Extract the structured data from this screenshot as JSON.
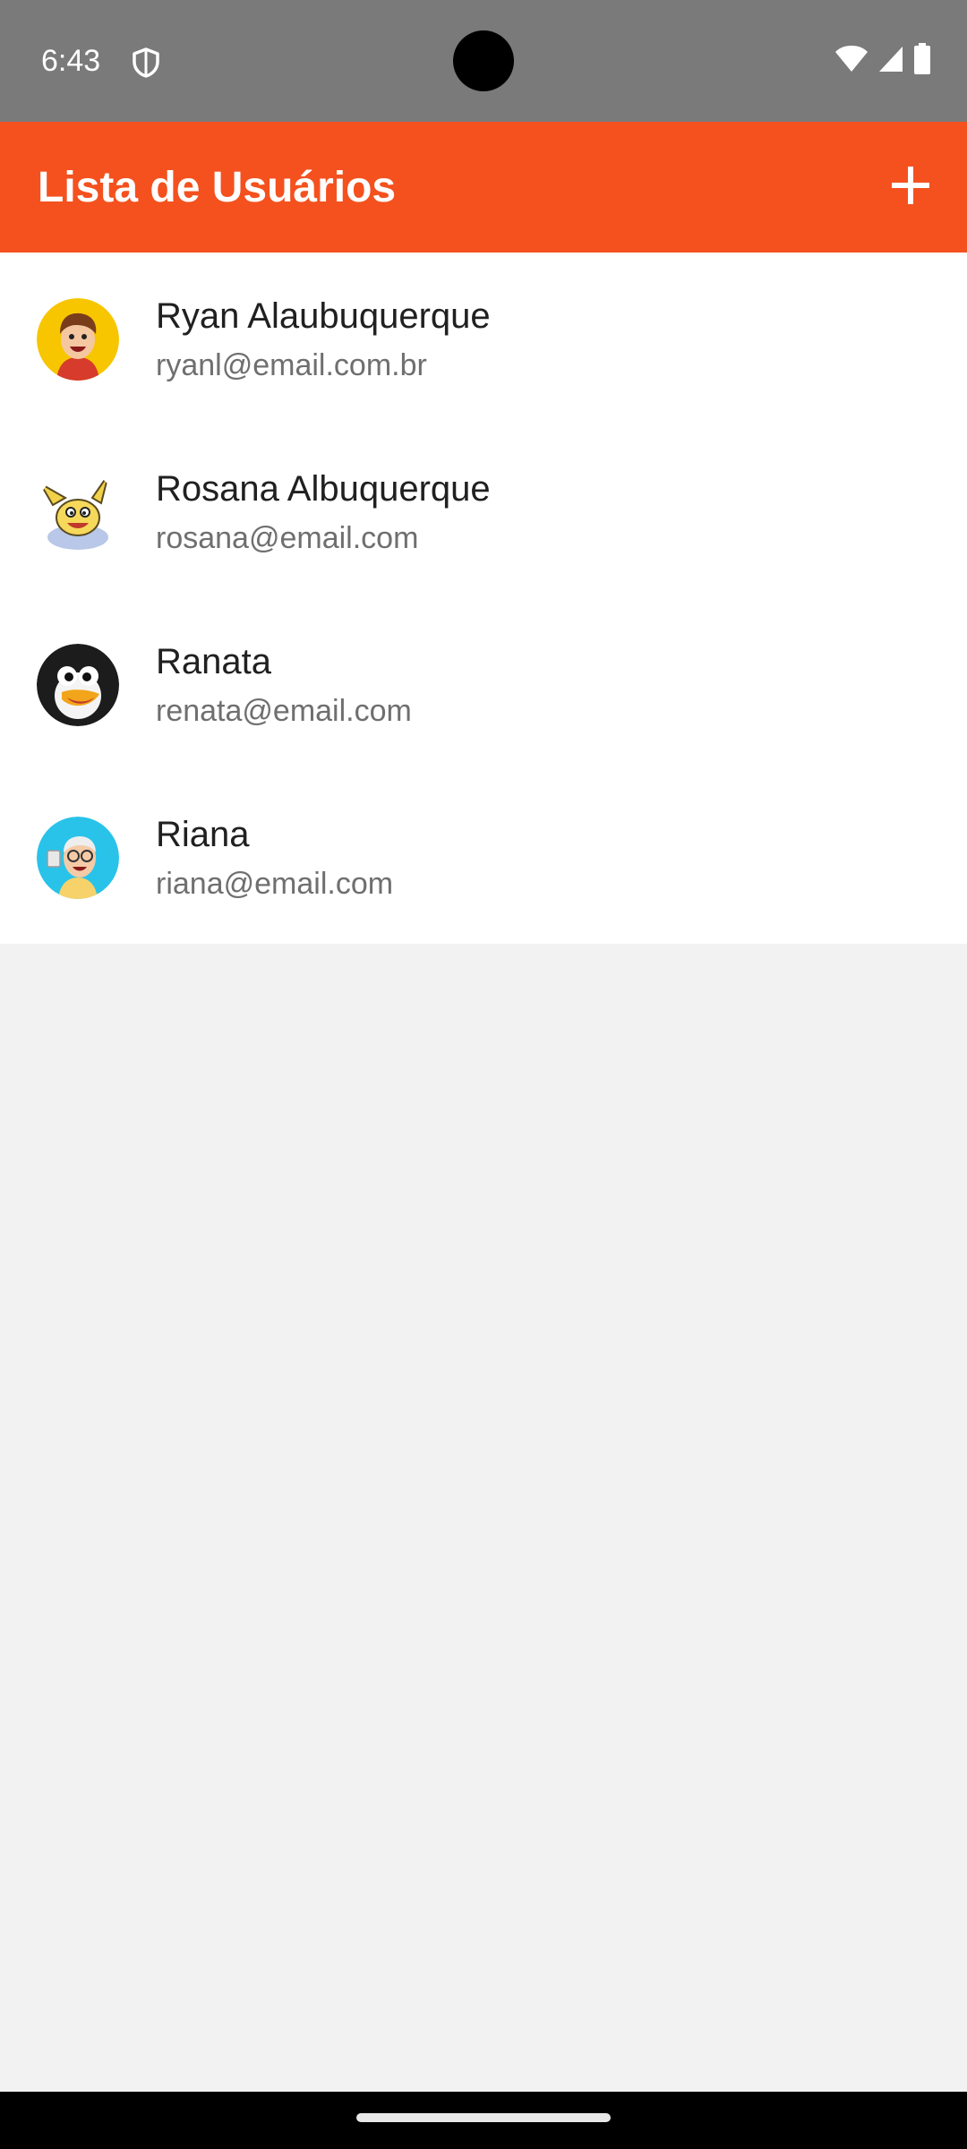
{
  "status_bar": {
    "time": "6:43",
    "icons": [
      "shield-icon",
      "wifi-icon",
      "signal-icon",
      "battery-icon"
    ]
  },
  "app_bar": {
    "title": "Lista de Usuários",
    "add_icon": "plus-icon",
    "color": "#f4511e"
  },
  "users": [
    {
      "name": "Ryan Alaubuquerque",
      "email": "ryanl@email.com.br",
      "avatar": "cartoon-boy-avatar"
    },
    {
      "name": "Rosana Albuquerque",
      "email": "rosana@email.com",
      "avatar": "cartoon-rabbit-avatar"
    },
    {
      "name": "Ranata",
      "email": "renata@email.com",
      "avatar": "cartoon-penguin-avatar"
    },
    {
      "name": "Riana",
      "email": "riana@email.com",
      "avatar": "cartoon-old-man-avatar"
    }
  ]
}
